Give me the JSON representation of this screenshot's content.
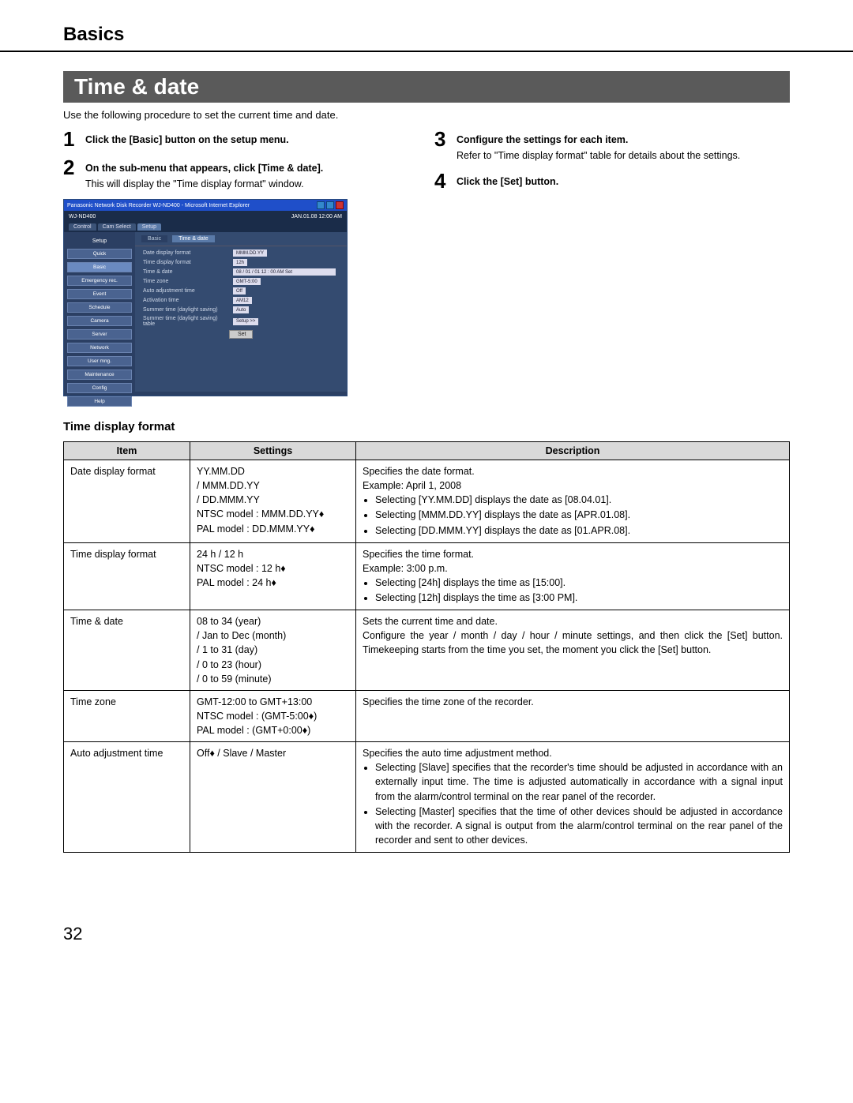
{
  "chapter_title": "Basics",
  "section_title": "Time & date",
  "intro": "Use the following procedure to set the current time and date.",
  "steps_left": [
    {
      "num": "1",
      "bold": "Click the [Basic] button on the setup menu.",
      "normal": ""
    },
    {
      "num": "2",
      "bold": "On the sub-menu that appears, click [Time & date].",
      "normal": "This will display the \"Time display format\" window."
    }
  ],
  "steps_right": [
    {
      "num": "3",
      "bold": "Configure the settings for each item.",
      "normal": "Refer to \"Time display format\" table for details about the settings."
    },
    {
      "num": "4",
      "bold": "Click the [Set] button.",
      "normal": ""
    }
  ],
  "screenshot": {
    "titlebar": "Panasonic   Network Disk Recorder WJ-ND400 - Microsoft Internet Explorer",
    "model": "WJ-ND400",
    "clock": "JAN.01.08 12:00 AM",
    "top_tabs": [
      "Control",
      "Cam Select",
      "Setup"
    ],
    "sidebar_title": "Setup",
    "sidebar_items": [
      "Quick",
      "Basic",
      "Emergency rec.",
      "Event",
      "Schedule",
      "Camera",
      "Server",
      "Network",
      "User mng.",
      "Maintenance",
      "Config",
      "Help"
    ],
    "main_tabs": [
      "Basic",
      "Time & date"
    ],
    "form_rows": [
      {
        "label": "Date display format",
        "value": "MMM.DD.YY"
      },
      {
        "label": "Time display format",
        "value": "12h"
      },
      {
        "label": "Time & date",
        "value": "08 / 01 / 01   12 : 00  AM   Set"
      },
      {
        "label": "Time zone",
        "value": "GMT-5:00"
      },
      {
        "label": "Auto adjustment time",
        "value": "Off"
      },
      {
        "label": "Activation time",
        "value": "AM12"
      },
      {
        "label": "Summer time (daylight saving)",
        "value": "Auto"
      },
      {
        "label": "Summer time (daylight saving) table",
        "value": "Setup >>"
      }
    ],
    "set_button": "Set"
  },
  "table_heading": "Time display format",
  "table_headers": {
    "item": "Item",
    "settings": "Settings",
    "description": "Description"
  },
  "table_rows": [
    {
      "item": "Date display format",
      "settings": "YY.MM.DD\n/ MMM.DD.YY\n/ DD.MMM.YY\nNTSC model : MMM.DD.YY♦\nPAL model    : DD.MMM.YY♦",
      "desc_intro": "Specifies the date format.\nExample: April 1, 2008",
      "desc_bullets": [
        "Selecting [YY.MM.DD] displays the date as [08.04.01].",
        "Selecting [MMM.DD.YY] displays the date as [APR.01.08].",
        "Selecting [DD.MMM.YY] displays the date as [01.APR.08]."
      ]
    },
    {
      "item": "Time display format",
      "settings": "24 h / 12 h\nNTSC model : 12 h♦\nPAL model    : 24 h♦",
      "desc_intro": "Specifies the time format.\nExample: 3:00 p.m.",
      "desc_bullets": [
        "Selecting [24h] displays the time as [15:00].",
        "Selecting [12h] displays the time as [3:00 PM]."
      ]
    },
    {
      "item": "Time & date",
      "settings": "08 to 34 (year)\n/ Jan to Dec (month)\n/ 1 to 31 (day)\n/ 0 to 23 (hour)\n/ 0 to 59 (minute)",
      "desc_intro": "Sets the current time and date.\nConfigure the year / month / day / hour / minute settings, and then click the [Set] button. Timekeeping starts from the time you set, the moment you click the [Set] button.",
      "desc_bullets": []
    },
    {
      "item": "Time zone",
      "settings": "GMT-12:00 to GMT+13:00\nNTSC model : (GMT-5:00♦)\nPAL model    : (GMT+0:00♦)",
      "desc_intro": "Specifies the time zone of the recorder.",
      "desc_bullets": []
    },
    {
      "item": "Auto adjustment time",
      "settings": "Off♦ / Slave / Master",
      "desc_intro": "Specifies the auto time adjustment method.",
      "desc_bullets": [
        "Selecting [Slave] specifies that the recorder's time should be adjusted in accordance with an externally input time. The time is adjusted automatically in accordance with a signal input from the alarm/control terminal on the rear panel of the recorder.",
        "Selecting [Master] specifies that the time of other devices should be adjusted in accordance with the recorder. A signal is output from the alarm/control terminal on the rear panel of the recorder and sent to other devices."
      ]
    }
  ],
  "page_number": "32"
}
